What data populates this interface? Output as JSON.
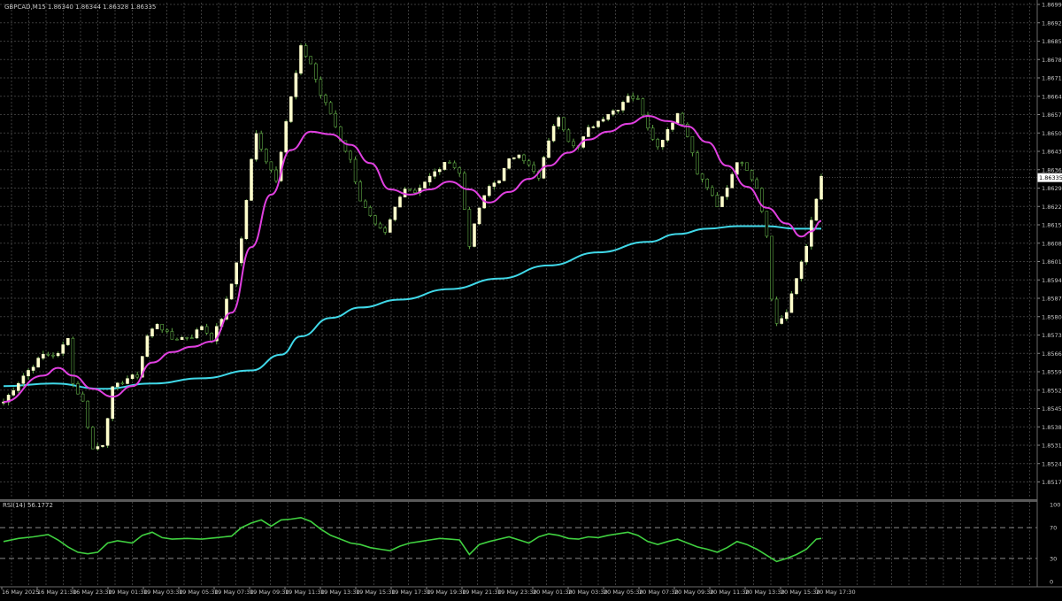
{
  "header": {
    "symbol_info": "GBPCAD,M15  1.86340 1.86344 1.86328 1.86335",
    "rsi_info": "RSI(14) 56.1772"
  },
  "colors": {
    "background": "#000000",
    "grid": "#3a3a3a",
    "axis_text": "#c8c8c8",
    "bull_candle": "#ffffcc",
    "bear_candle": "#000000",
    "candle_wick": "#5fa845",
    "fast_ma": "#e040e0",
    "slow_ma": "#40d8e8",
    "rsi_line": "#40d040",
    "current_price_bg": "#ffffff"
  },
  "chart_data": [
    {
      "type": "candlestick",
      "symbol": "GBPCAD",
      "timeframe": "M15",
      "grid": true,
      "y_ticks": [
        "1.86995",
        "1.86925",
        "1.86855",
        "1.86785",
        "1.86715",
        "1.86645",
        "1.86575",
        "1.86505",
        "1.86435",
        "1.86365",
        "1.86295",
        "1.86225",
        "1.86155",
        "1.86085",
        "1.86015",
        "1.85945",
        "1.85875",
        "1.85805",
        "1.85735",
        "1.85665",
        "1.85595",
        "1.85525",
        "1.85455",
        "1.85385",
        "1.85315",
        "1.85245",
        "1.85175"
      ],
      "x_ticks": [
        "16 May 2025",
        "16 May 21:30",
        "16 May 23:30",
        "19 May 01:30",
        "19 May 03:30",
        "19 May 05:30",
        "19 May 07:30",
        "19 May 09:30",
        "19 May 11:30",
        "19 May 13:30",
        "19 May 15:30",
        "19 May 17:30",
        "19 May 19:30",
        "19 May 21:30",
        "19 May 23:30",
        "20 May 01:30",
        "20 May 03:30",
        "20 May 05:30",
        "20 May 07:30",
        "20 May 09:30",
        "20 May 11:30",
        "20 May 13:30",
        "20 May 15:30",
        "20 May 17:30"
      ],
      "current_price": "1.86335",
      "anchors": [
        [
          0,
          1.8548
        ],
        [
          4,
          1.8558
        ],
        [
          8,
          1.8566
        ],
        [
          11,
          1.8566
        ],
        [
          13,
          1.8573
        ],
        [
          14,
          1.8555
        ],
        [
          16,
          1.8548
        ],
        [
          18,
          1.853
        ],
        [
          20,
          1.8532
        ],
        [
          22,
          1.8553
        ],
        [
          25,
          1.8557
        ],
        [
          27,
          1.8558
        ],
        [
          29,
          1.8573
        ],
        [
          31,
          1.8578
        ],
        [
          34,
          1.8572
        ],
        [
          38,
          1.8573
        ],
        [
          40,
          1.8577
        ],
        [
          42,
          1.8572
        ],
        [
          44,
          1.858
        ],
        [
          46,
          1.8593
        ],
        [
          48,
          1.861
        ],
        [
          50,
          1.864
        ],
        [
          51,
          1.865
        ],
        [
          53,
          1.864
        ],
        [
          55,
          1.8633
        ],
        [
          57,
          1.8655
        ],
        [
          59,
          1.8673
        ],
        [
          60,
          1.8683
        ],
        [
          62,
          1.8677
        ],
        [
          64,
          1.8665
        ],
        [
          66,
          1.8658
        ],
        [
          68,
          1.8648
        ],
        [
          70,
          1.864
        ],
        [
          72,
          1.8625
        ],
        [
          75,
          1.8615
        ],
        [
          77,
          1.8612
        ],
        [
          79,
          1.8622
        ],
        [
          81,
          1.863
        ],
        [
          83,
          1.8628
        ],
        [
          85,
          1.8632
        ],
        [
          88,
          1.8637
        ],
        [
          90,
          1.864
        ],
        [
          92,
          1.8635
        ],
        [
          94,
          1.8608
        ],
        [
          96,
          1.8622
        ],
        [
          98,
          1.863
        ],
        [
          100,
          1.8633
        ],
        [
          102,
          1.864
        ],
        [
          104,
          1.8643
        ],
        [
          106,
          1.8638
        ],
        [
          108,
          1.8633
        ],
        [
          110,
          1.8648
        ],
        [
          112,
          1.8657
        ],
        [
          114,
          1.8648
        ],
        [
          116,
          1.8645
        ],
        [
          118,
          1.8652
        ],
        [
          120,
          1.8655
        ],
        [
          122,
          1.8658
        ],
        [
          124,
          1.866
        ],
        [
          126,
          1.8665
        ],
        [
          128,
          1.8663
        ],
        [
          130,
          1.8653
        ],
        [
          132,
          1.8645
        ],
        [
          134,
          1.8652
        ],
        [
          136,
          1.8658
        ],
        [
          138,
          1.865
        ],
        [
          140,
          1.8635
        ],
        [
          142,
          1.863
        ],
        [
          144,
          1.8622
        ],
        [
          146,
          1.863
        ],
        [
          148,
          1.864
        ],
        [
          150,
          1.8637
        ],
        [
          152,
          1.863
        ],
        [
          154,
          1.8612
        ],
        [
          155,
          1.8587
        ],
        [
          156,
          1.8578
        ],
        [
          158,
          1.8582
        ],
        [
          160,
          1.8595
        ],
        [
          162,
          1.8608
        ],
        [
          164,
          1.8625
        ],
        [
          165,
          1.8634
        ]
      ],
      "series": [
        {
          "name": "fast_ma",
          "points": [
            [
              0,
              1.8548
            ],
            [
              8,
              1.8558
            ],
            [
              11,
              1.8561
            ],
            [
              14,
              1.8558
            ],
            [
              18,
              1.8553
            ],
            [
              22,
              1.855
            ],
            [
              26,
              1.8554
            ],
            [
              30,
              1.8563
            ],
            [
              34,
              1.8567
            ],
            [
              38,
              1.8569
            ],
            [
              42,
              1.8571
            ],
            [
              46,
              1.8582
            ],
            [
              50,
              1.8607
            ],
            [
              54,
              1.8627
            ],
            [
              58,
              1.8644
            ],
            [
              62,
              1.8651
            ],
            [
              66,
              1.865
            ],
            [
              70,
              1.8646
            ],
            [
              74,
              1.8639
            ],
            [
              78,
              1.8629
            ],
            [
              82,
              1.8627
            ],
            [
              86,
              1.8629
            ],
            [
              90,
              1.8632
            ],
            [
              94,
              1.8629
            ],
            [
              98,
              1.8624
            ],
            [
              102,
              1.8628
            ],
            [
              106,
              1.8633
            ],
            [
              110,
              1.8638
            ],
            [
              114,
              1.8643
            ],
            [
              118,
              1.8648
            ],
            [
              122,
              1.8651
            ],
            [
              126,
              1.8654
            ],
            [
              130,
              1.8657
            ],
            [
              134,
              1.8655
            ],
            [
              138,
              1.8653
            ],
            [
              142,
              1.8647
            ],
            [
              146,
              1.8638
            ],
            [
              150,
              1.863
            ],
            [
              154,
              1.8622
            ],
            [
              158,
              1.8616
            ],
            [
              161,
              1.8611
            ],
            [
              163,
              1.8613
            ],
            [
              165,
              1.8617
            ]
          ]
        },
        {
          "name": "slow_ma",
          "points": [
            [
              0,
              1.8554
            ],
            [
              10,
              1.8555
            ],
            [
              20,
              1.8553
            ],
            [
              30,
              1.8555
            ],
            [
              40,
              1.8557
            ],
            [
              50,
              1.856
            ],
            [
              56,
              1.8566
            ],
            [
              60,
              1.8573
            ],
            [
              66,
              1.858
            ],
            [
              72,
              1.8584
            ],
            [
              80,
              1.8587
            ],
            [
              90,
              1.8591
            ],
            [
              100,
              1.8595
            ],
            [
              110,
              1.86
            ],
            [
              120,
              1.8605
            ],
            [
              130,
              1.8609
            ],
            [
              136,
              1.8612
            ],
            [
              142,
              1.8614
            ],
            [
              148,
              1.8615
            ],
            [
              154,
              1.8615
            ],
            [
              160,
              1.8614
            ],
            [
              165,
              1.8614
            ]
          ]
        }
      ]
    },
    {
      "type": "line",
      "indicator": "RSI(14)",
      "ylim": [
        0,
        100
      ],
      "y_ticks": [
        "100",
        "70",
        "30",
        "0"
      ],
      "levels": [
        70,
        30
      ],
      "series": [
        {
          "name": "RSI(14)",
          "points": [
            [
              0,
              52
            ],
            [
              3,
              56
            ],
            [
              6,
              58
            ],
            [
              9,
              61
            ],
            [
              11,
              54
            ],
            [
              13,
              45
            ],
            [
              15,
              38
            ],
            [
              17,
              36
            ],
            [
              19,
              38
            ],
            [
              21,
              50
            ],
            [
              23,
              53
            ],
            [
              26,
              50
            ],
            [
              28,
              60
            ],
            [
              30,
              64
            ],
            [
              32,
              57
            ],
            [
              34,
              55
            ],
            [
              37,
              56
            ],
            [
              40,
              55
            ],
            [
              43,
              57
            ],
            [
              46,
              59
            ],
            [
              48,
              70
            ],
            [
              50,
              76
            ],
            [
              52,
              80
            ],
            [
              54,
              72
            ],
            [
              56,
              80
            ],
            [
              58,
              81
            ],
            [
              60,
              83
            ],
            [
              62,
              78
            ],
            [
              64,
              68
            ],
            [
              66,
              60
            ],
            [
              68,
              55
            ],
            [
              70,
              50
            ],
            [
              72,
              48
            ],
            [
              74,
              44
            ],
            [
              76,
              42
            ],
            [
              78,
              40
            ],
            [
              80,
              46
            ],
            [
              82,
              50
            ],
            [
              84,
              52
            ],
            [
              86,
              54
            ],
            [
              88,
              56
            ],
            [
              90,
              55
            ],
            [
              92,
              54
            ],
            [
              94,
              35
            ],
            [
              96,
              48
            ],
            [
              98,
              52
            ],
            [
              100,
              55
            ],
            [
              102,
              58
            ],
            [
              104,
              54
            ],
            [
              106,
              50
            ],
            [
              108,
              58
            ],
            [
              110,
              62
            ],
            [
              112,
              60
            ],
            [
              114,
              56
            ],
            [
              116,
              55
            ],
            [
              118,
              58
            ],
            [
              120,
              57
            ],
            [
              122,
              60
            ],
            [
              124,
              62
            ],
            [
              126,
              64
            ],
            [
              128,
              60
            ],
            [
              130,
              52
            ],
            [
              132,
              48
            ],
            [
              134,
              52
            ],
            [
              136,
              55
            ],
            [
              138,
              50
            ],
            [
              140,
              45
            ],
            [
              142,
              42
            ],
            [
              144,
              38
            ],
            [
              146,
              44
            ],
            [
              148,
              52
            ],
            [
              150,
              48
            ],
            [
              152,
              42
            ],
            [
              154,
              34
            ],
            [
              156,
              26
            ],
            [
              158,
              30
            ],
            [
              160,
              35
            ],
            [
              162,
              42
            ],
            [
              164,
              55
            ],
            [
              165,
              56
            ]
          ]
        }
      ]
    }
  ]
}
